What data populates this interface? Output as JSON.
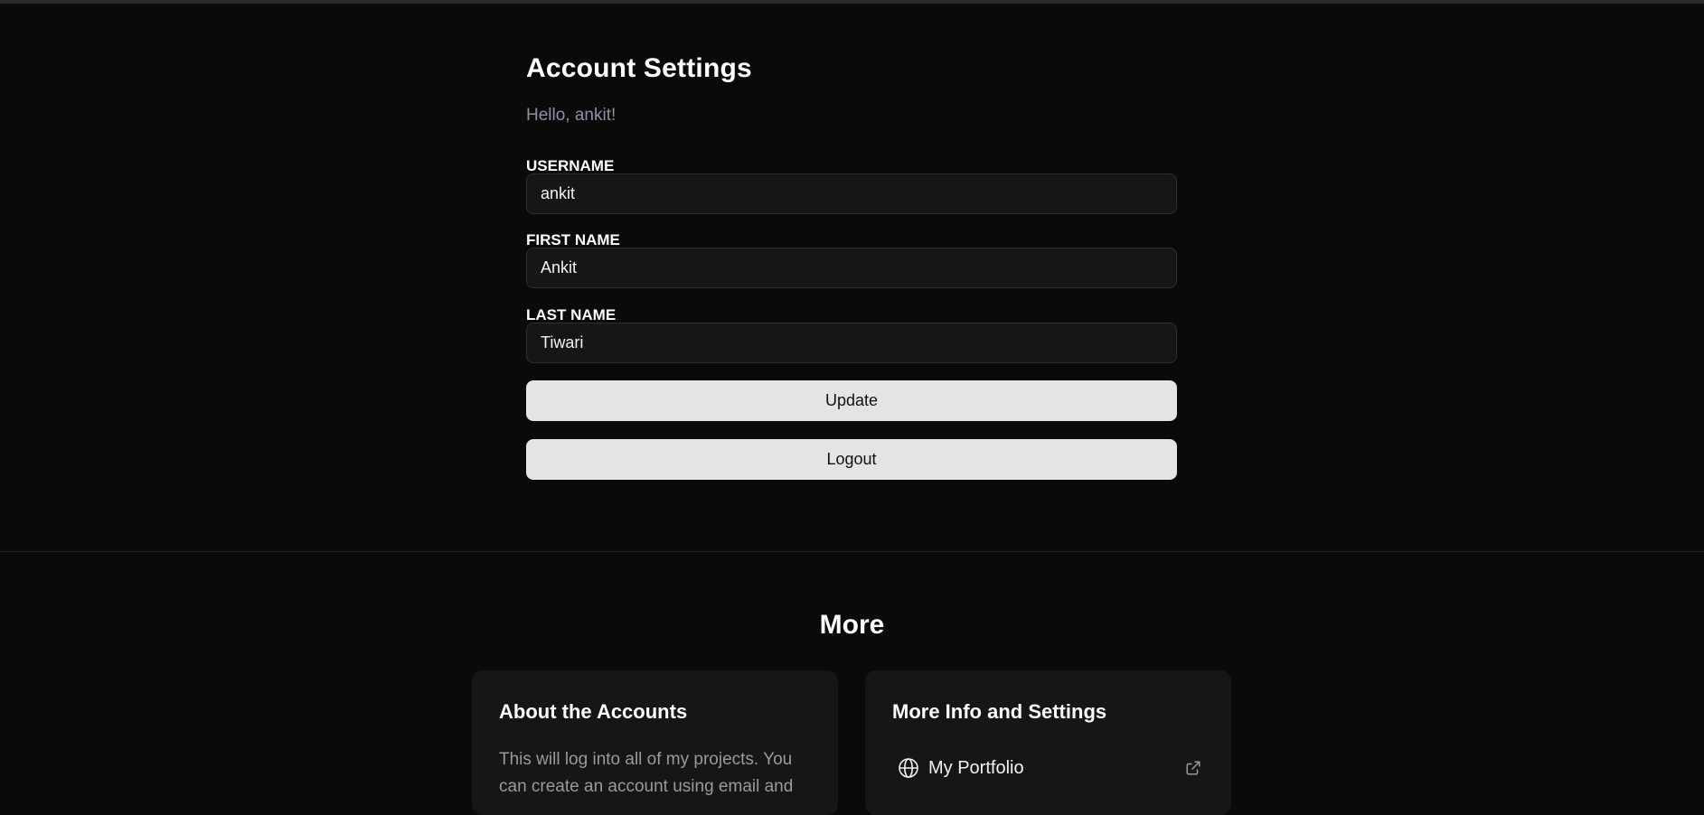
{
  "settings": {
    "title": "Account Settings",
    "greeting": "Hello, ankit!",
    "fields": [
      {
        "label": "USERNAME",
        "value": "ankit"
      },
      {
        "label": "FIRST NAME",
        "value": "Ankit"
      },
      {
        "label": "LAST NAME",
        "value": "Tiwari"
      }
    ],
    "update_label": "Update",
    "logout_label": "Logout"
  },
  "more": {
    "title": "More",
    "about": {
      "title": "About the Accounts",
      "text": "This will log into all of my projects. You can create an account using email and"
    },
    "info": {
      "title": "More Info and Settings",
      "links": [
        {
          "label": "My Portfolio",
          "icon": "globe-icon",
          "trailing_icon": "external-link-icon"
        }
      ]
    }
  },
  "colors": {
    "background": "#0a0a0a",
    "input_background": "#161616",
    "button_background": "#e4e4e4",
    "card_background": "#161616",
    "greeting": "#8a93a6"
  }
}
